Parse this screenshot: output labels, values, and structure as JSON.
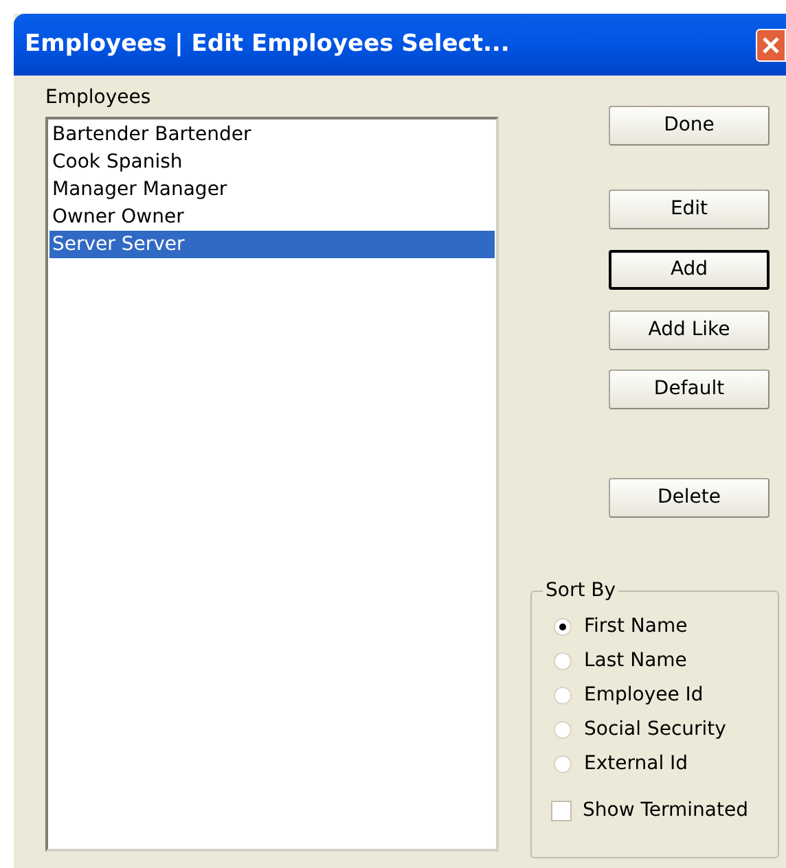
{
  "window": {
    "title": "Employees | Edit Employees Select..."
  },
  "list": {
    "label": "Employees",
    "items": [
      {
        "text": "Bartender Bartender",
        "selected": false
      },
      {
        "text": "Cook Spanish",
        "selected": false
      },
      {
        "text": "Manager Manager",
        "selected": false
      },
      {
        "text": "Owner Owner",
        "selected": false
      },
      {
        "text": "Server Server",
        "selected": true
      }
    ]
  },
  "buttons": [
    {
      "label": "Done",
      "default": false
    },
    {
      "label": "Edit",
      "default": false
    },
    {
      "label": "Add",
      "default": true
    },
    {
      "label": "Add Like",
      "default": false
    },
    {
      "label": "Default",
      "default": false
    },
    {
      "label": "Delete",
      "default": false
    }
  ],
  "sort_by": {
    "title": "Sort By",
    "options": [
      {
        "label": "First Name",
        "selected": true
      },
      {
        "label": "Last Name",
        "selected": false
      },
      {
        "label": "Employee Id",
        "selected": false
      },
      {
        "label": "Social Security",
        "selected": false
      },
      {
        "label": "External Id",
        "selected": false
      }
    ],
    "show_terminated": {
      "label": "Show Terminated",
      "checked": false
    }
  }
}
